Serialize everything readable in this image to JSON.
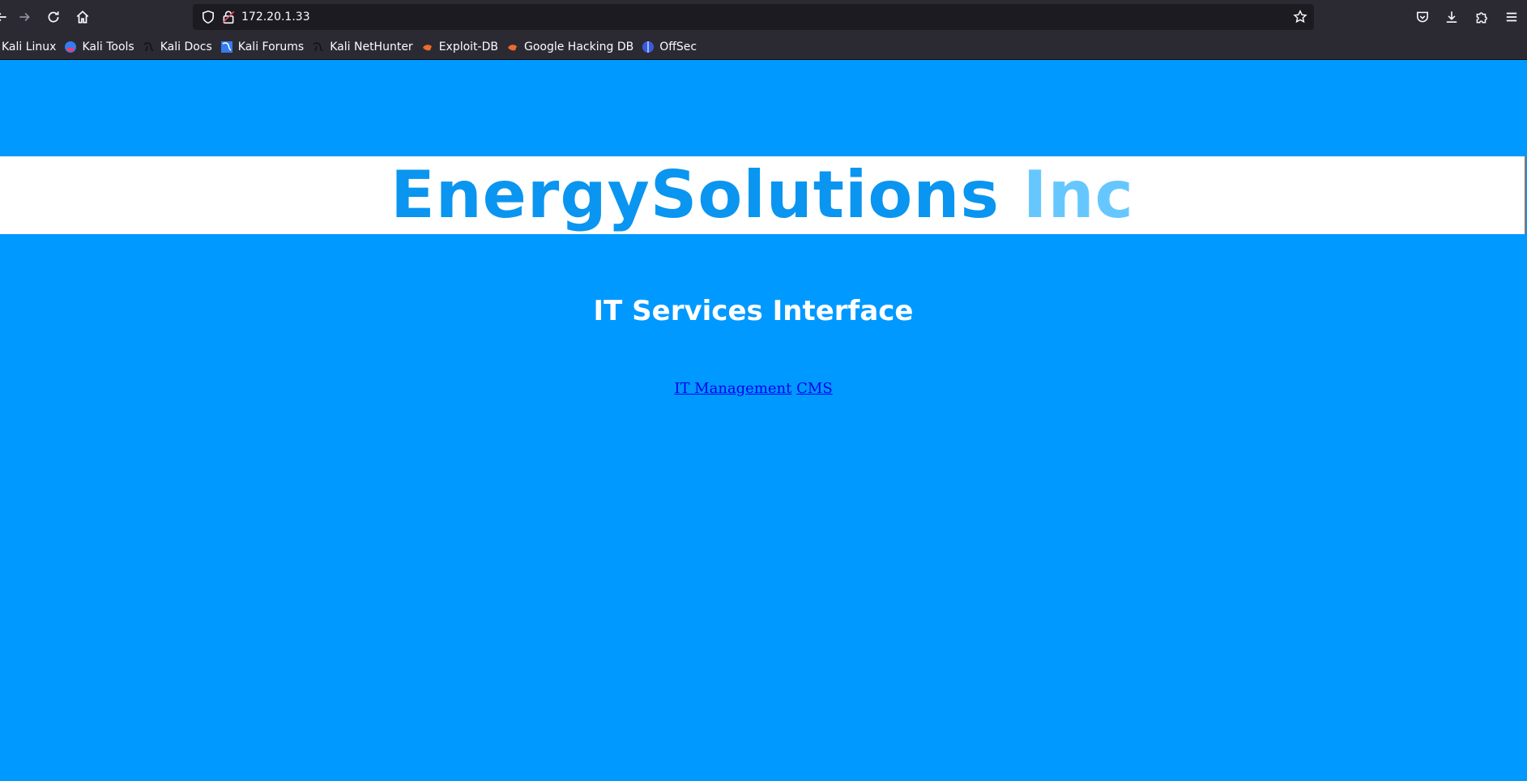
{
  "browser": {
    "url": "172.20.1.33",
    "bookmarks": [
      {
        "label": "Kali Linux",
        "icon": "kali-dragon-icon"
      },
      {
        "label": "Kali Tools",
        "icon": "kali-tools-icon"
      },
      {
        "label": "Kali Docs",
        "icon": "kali-dragon-icon"
      },
      {
        "label": "Kali Forums",
        "icon": "kali-forums-icon"
      },
      {
        "label": "Kali NetHunter",
        "icon": "kali-dragon-icon"
      },
      {
        "label": "Exploit-DB",
        "icon": "exploit-db-icon"
      },
      {
        "label": "Google Hacking DB",
        "icon": "exploit-db-icon"
      },
      {
        "label": "OffSec",
        "icon": "offsec-icon"
      }
    ]
  },
  "page": {
    "brand_main": "EnergySolutions",
    "brand_suffix": "Inc",
    "subtitle": "IT Services Interface",
    "links": [
      {
        "label": "IT Management"
      },
      {
        "label": "CMS"
      }
    ]
  },
  "colors": {
    "page_background": "#0099ff",
    "brand_main": "#0a95f0",
    "brand_suffix": "#66c7ff",
    "link": "#0000ee"
  }
}
